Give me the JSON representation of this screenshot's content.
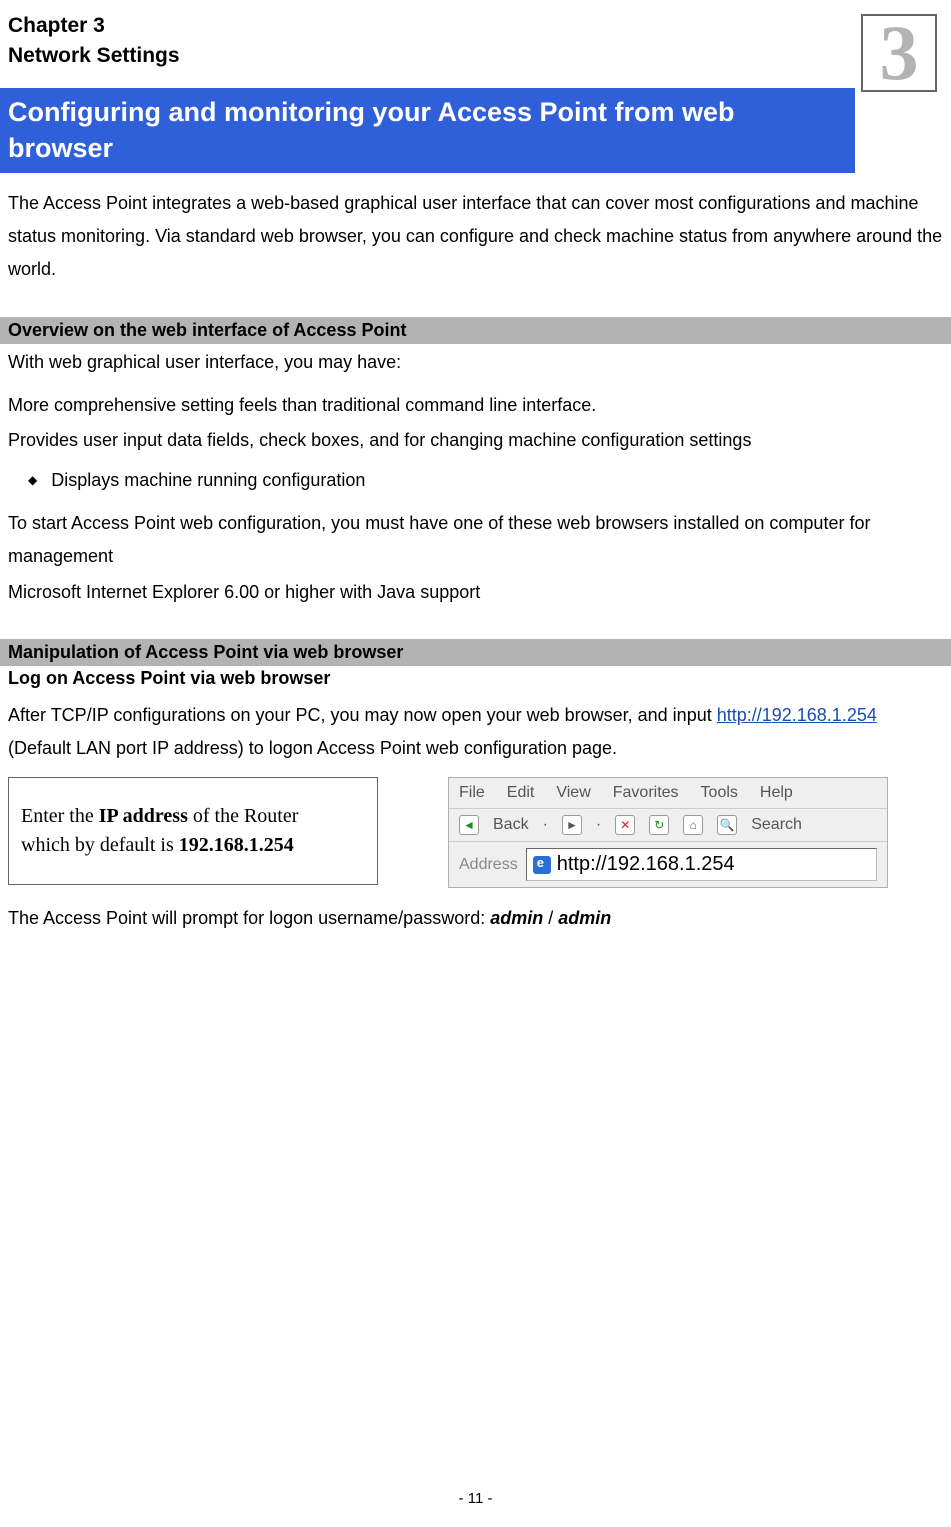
{
  "chapter": {
    "title": "Chapter 3",
    "subtitle": "Network Settings",
    "badge_number": "3"
  },
  "heading_blue": "Configuring and monitoring your Access Point from web browser",
  "intro_paragraph": "The Access Point integrates a web-based graphical user interface that can cover most configurations and machine status monitoring. Via standard web browser, you can configure and check machine status from anywhere around the world.",
  "overview": {
    "bar_title": "Overview on the web interface of Access Point",
    "line1": "With web graphical user interface, you may have:",
    "para1": "More comprehensive setting feels than traditional command line interface.",
    "para2": "Provides user input data fields, check boxes, and for changing machine configuration settings",
    "bullet1": "Displays machine running configuration",
    "para3": "To start Access Point web configuration, you must have one of these web browsers installed on computer for management",
    "para4": "Microsoft Internet Explorer 6.00 or higher with Java support"
  },
  "manipulation": {
    "bar_title": "Manipulation of Access Point via web browser",
    "subheading": "Log on Access Point via web browser",
    "para_before_link": "After TCP/IP configurations on your PC, you may now open your web browser, and input ",
    "link_text": "http://192.168.1.254",
    "para_after_link": " (Default LAN port IP address) to logon Access Point web configuration page."
  },
  "ipbox": {
    "line1_a": "Enter the ",
    "line1_b": "IP address",
    "line1_c": " of the Router",
    "line2_a": "which by default is ",
    "line2_b": "192.168.1.254"
  },
  "browser": {
    "menu": {
      "file": "File",
      "edit": "Edit",
      "view": "View",
      "favorites": "Favorites",
      "tools": "Tools",
      "help": "Help"
    },
    "toolbar": {
      "back": "Back",
      "search": "Search"
    },
    "address_label": "Address",
    "address_value": "http://192.168.1.254"
  },
  "logon": {
    "prefix": "The Access Point will prompt for logon username/password: ",
    "user": "admin",
    "sep": " / ",
    "pass": "admin"
  },
  "page_number": "- 11 -"
}
